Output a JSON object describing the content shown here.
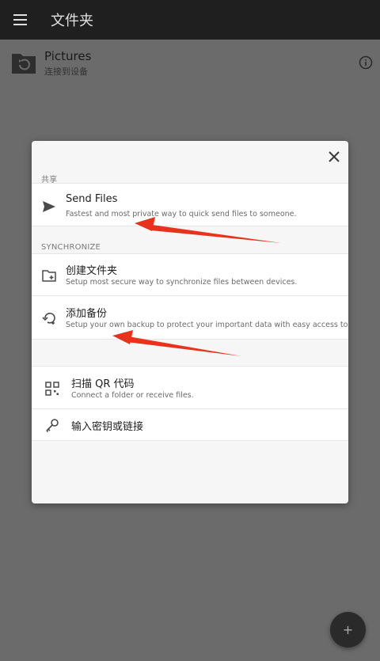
{
  "app_bar": {
    "title": "文件夹",
    "menu_icon": "hamburger-menu-icon"
  },
  "folder": {
    "name": "Pictures",
    "status": "连接到设备",
    "icon": "folder-sync-icon",
    "info_icon": "info-icon"
  },
  "dialog": {
    "sections": [
      {
        "label": "共享"
      },
      {
        "label": "SYNCHRONIZE"
      }
    ],
    "items": [
      {
        "title": "Send Files",
        "subtitle": "Fastest and most private way to quick send files to someone.",
        "icon": "send-icon"
      },
      {
        "title": "创建文件夹",
        "subtitle": "Setup most secure way to synchronize files between devices.",
        "icon": "create-folder-icon"
      },
      {
        "title": "添加备份",
        "subtitle": "Setup your own backup to protect your important data with easy access to it.",
        "icon": "backup-restore-icon"
      },
      {
        "title": "扫描 QR 代码",
        "subtitle": "Connect a folder or receive files.",
        "icon": "qr-code-icon"
      },
      {
        "title": "输入密钥或链接",
        "subtitle": "",
        "icon": "key-icon"
      }
    ],
    "close_icon": "close-icon"
  },
  "fab": {
    "label": "+"
  },
  "colors": {
    "appbar": "#1f1f1f",
    "scrim": "#6b6b6b",
    "arrow": "#e8321c"
  }
}
